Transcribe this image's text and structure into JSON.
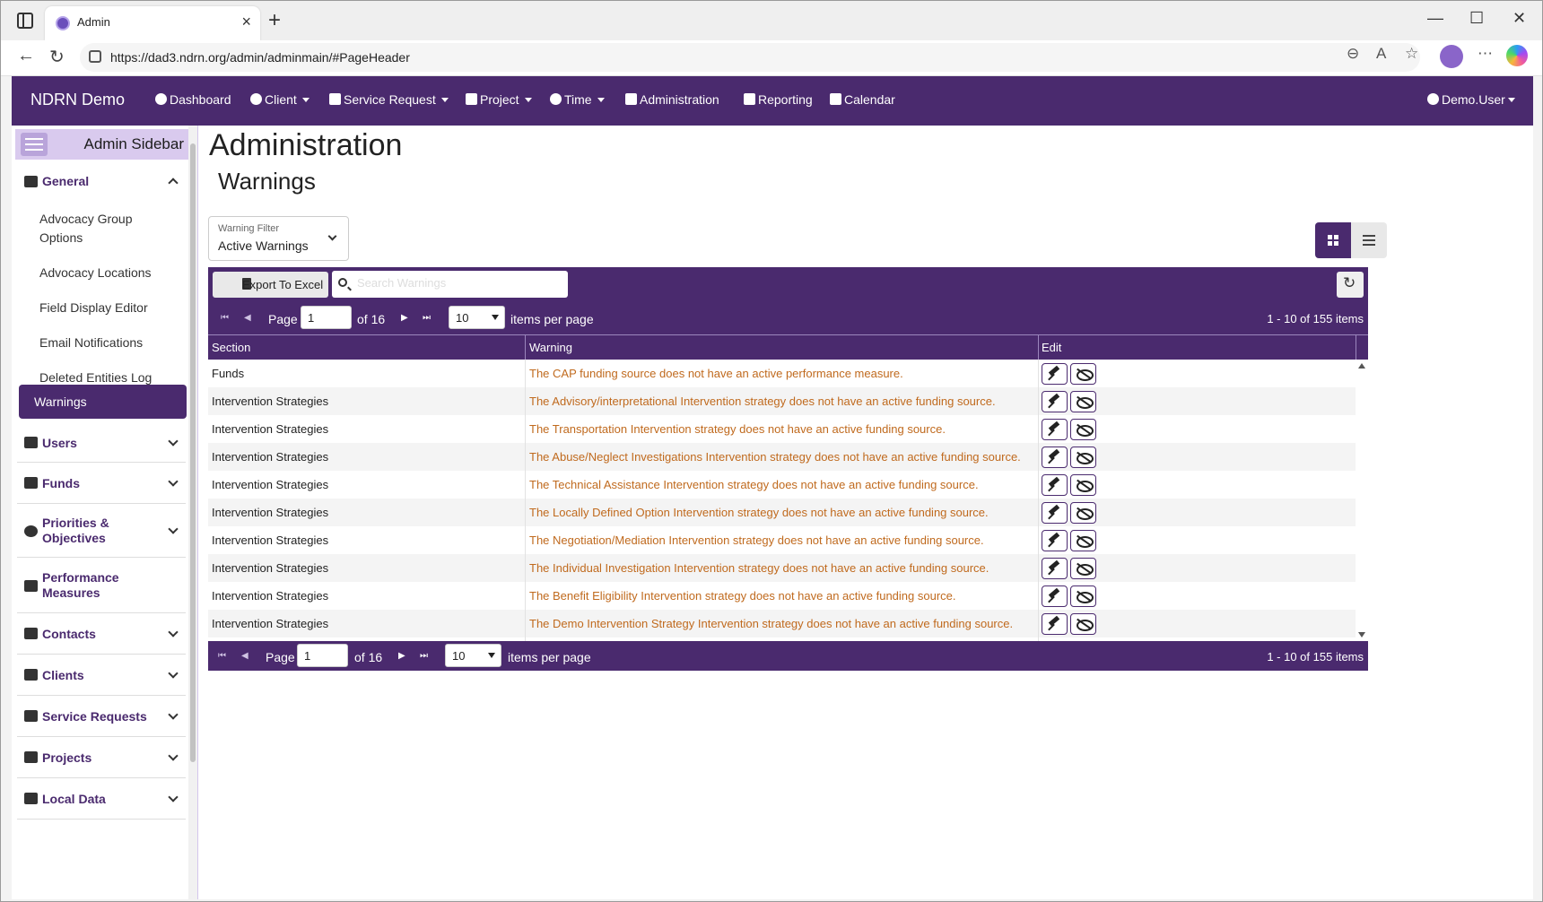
{
  "browser": {
    "tab_title": "Admin",
    "url": "https://dad3.ndrn.org/admin/adminmain/#PageHeader"
  },
  "navbar": {
    "brand": "NDRN Demo",
    "items": [
      {
        "label": "Dashboard",
        "icon": "dashboard-icon",
        "dropdown": false
      },
      {
        "label": "Client",
        "icon": "user-icon",
        "dropdown": true
      },
      {
        "label": "Service Request",
        "icon": "briefcase-icon",
        "dropdown": true
      },
      {
        "label": "Project",
        "icon": "clipboard-icon",
        "dropdown": true
      },
      {
        "label": "Time",
        "icon": "clock-icon",
        "dropdown": true
      },
      {
        "label": "Administration",
        "icon": "tools-icon",
        "dropdown": false
      },
      {
        "label": "Reporting",
        "icon": "file-icon",
        "dropdown": false
      },
      {
        "label": "Calendar",
        "icon": "calendar-icon",
        "dropdown": false
      }
    ],
    "user": "Demo.User"
  },
  "sidebar": {
    "title": "Admin Sidebar",
    "general": {
      "label": "General",
      "items": [
        "Advocacy Group Options",
        "Advocacy Locations",
        "Field Display Editor",
        "Email Notifications",
        "Deleted Entities Log",
        "Warnings"
      ],
      "active": "Warnings"
    },
    "groups": [
      {
        "label": "Users",
        "icon": "users-icon"
      },
      {
        "label": "Funds",
        "icon": "money-bag-icon"
      },
      {
        "label": "Priorities & Objectives",
        "icon": "target-icon"
      },
      {
        "label": "Performance Measures",
        "icon": "balance-scale-icon"
      },
      {
        "label": "Contacts",
        "icon": "contacts-icon"
      },
      {
        "label": "Clients",
        "icon": "user-icon"
      },
      {
        "label": "Service Requests",
        "icon": "briefcase-icon"
      },
      {
        "label": "Projects",
        "icon": "clipboard-icon"
      },
      {
        "label": "Local Data",
        "icon": "folder-icon"
      }
    ]
  },
  "main": {
    "title": "Administration",
    "subtitle": "Warnings",
    "filter": {
      "label": "Warning Filter",
      "value": "Active Warnings"
    }
  },
  "grid": {
    "export_label": "Export To Excel",
    "search_placeholder": "Search Warnings",
    "pager": {
      "page_label": "Page",
      "page": "1",
      "of_label": "of 16",
      "page_size": "10",
      "items_per_page_label": "items per page",
      "info": "1 - 10 of 155 items"
    },
    "columns": [
      "Section",
      "Warning",
      "Edit"
    ],
    "rows": [
      {
        "section": "Funds",
        "warning": "The CAP funding source does not have an active performance measure."
      },
      {
        "section": "Intervention Strategies",
        "warning": "The Advisory/interpretational Intervention strategy does not have an active funding source."
      },
      {
        "section": "Intervention Strategies",
        "warning": "The Transportation Intervention strategy does not have an active funding source."
      },
      {
        "section": "Intervention Strategies",
        "warning": "The Abuse/Neglect Investigations Intervention strategy does not have an active funding source."
      },
      {
        "section": "Intervention Strategies",
        "warning": "The Technical Assistance Intervention strategy does not have an active funding source."
      },
      {
        "section": "Intervention Strategies",
        "warning": "The Locally Defined Option Intervention strategy does not have an active funding source."
      },
      {
        "section": "Intervention Strategies",
        "warning": "The Negotiation/Mediation Intervention strategy does not have an active funding source."
      },
      {
        "section": "Intervention Strategies",
        "warning": "The Individual Investigation Intervention strategy does not have an active funding source."
      },
      {
        "section": "Intervention Strategies",
        "warning": "The Benefit Eligibility Intervention strategy does not have an active funding source."
      },
      {
        "section": "Intervention Strategies",
        "warning": "The Demo Intervention Strategy Intervention strategy does not have an active funding source."
      }
    ]
  },
  "colors": {
    "primary": "#4a2a6e",
    "sidebar_header": "#d9caee",
    "warning_text": "#c06a1e"
  }
}
